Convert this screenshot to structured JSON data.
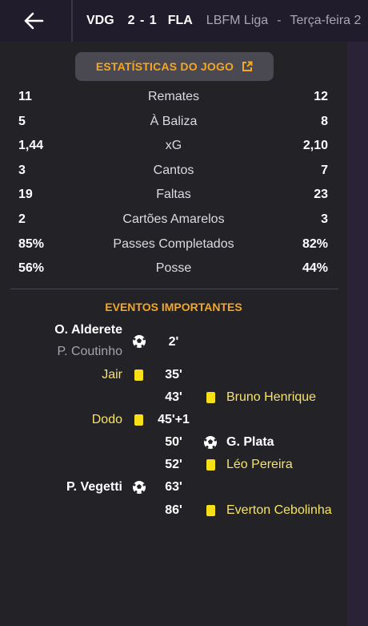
{
  "topbar": {
    "home_team": "VDG",
    "score": "2 - 1",
    "away_team": "FLA",
    "league": "LBFM Liga",
    "separator": "-",
    "date": "Terça-feira 2"
  },
  "stats_header": {
    "label": "ESTATÍSTICAS DO JOGO",
    "icon": "external-link-icon"
  },
  "stats": [
    {
      "home": "11",
      "label": "Remates",
      "away": "12"
    },
    {
      "home": "5",
      "label": "À Baliza",
      "away": "8"
    },
    {
      "home": "1,44",
      "label": "xG",
      "away": "2,10"
    },
    {
      "home": "3",
      "label": "Cantos",
      "away": "7"
    },
    {
      "home": "19",
      "label": "Faltas",
      "away": "23"
    },
    {
      "home": "2",
      "label": "Cartões Amarelos",
      "away": "3"
    },
    {
      "home": "85%",
      "label": "Passes Completados",
      "away": "82%"
    },
    {
      "home": "56%",
      "label": "Posse",
      "away": "44%"
    }
  ],
  "events": {
    "title": "EVENTOS IMPORTANTES",
    "items": [
      {
        "minute": "2'",
        "side": "home",
        "type": "goal",
        "player": "O. Alderete",
        "assist": "P. Coutinho"
      },
      {
        "minute": "35'",
        "side": "home",
        "type": "yellow-card",
        "player": "Jair"
      },
      {
        "minute": "43'",
        "side": "away",
        "type": "yellow-card",
        "player": "Bruno Henrique"
      },
      {
        "minute": "45'+1",
        "side": "home",
        "type": "yellow-card",
        "player": "Dodo"
      },
      {
        "minute": "50'",
        "side": "away",
        "type": "goal",
        "player": "G. Plata"
      },
      {
        "minute": "52'",
        "side": "away",
        "type": "yellow-card",
        "player": "Léo Pereira"
      },
      {
        "minute": "63'",
        "side": "home",
        "type": "goal",
        "player": "P. Vegetti"
      },
      {
        "minute": "86'",
        "side": "away",
        "type": "yellow-card",
        "player": "Everton Cebolinha"
      }
    ]
  },
  "colors": {
    "accent": "#f5a623",
    "card": "#f7e018",
    "background": "#232227"
  }
}
